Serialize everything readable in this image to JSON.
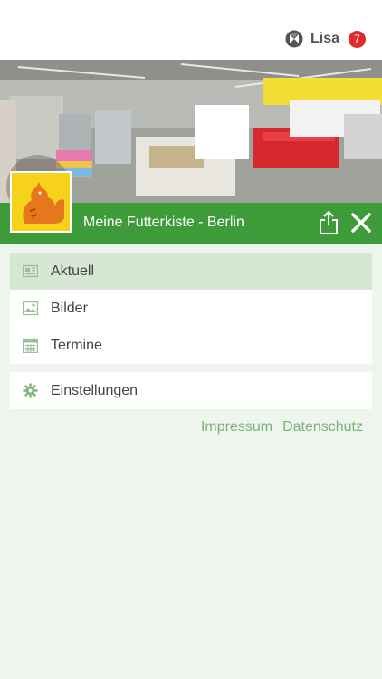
{
  "header": {
    "user_name": "Lisa",
    "notification_count": "7"
  },
  "store": {
    "title": "Meine Futterkiste - Berlin",
    "accent": "#3d9b3a"
  },
  "menu_primary": [
    {
      "label": "Aktuell",
      "icon": "newspaper-icon",
      "active": true
    },
    {
      "label": "Bilder",
      "icon": "image-icon",
      "active": false
    },
    {
      "label": "Termine",
      "icon": "calendar-icon",
      "active": false
    }
  ],
  "menu_secondary": [
    {
      "label": "Einstellungen",
      "icon": "gear-icon",
      "active": false
    }
  ],
  "footer_links": {
    "impressum": "Impressum",
    "datenschutz": "Datenschutz"
  }
}
